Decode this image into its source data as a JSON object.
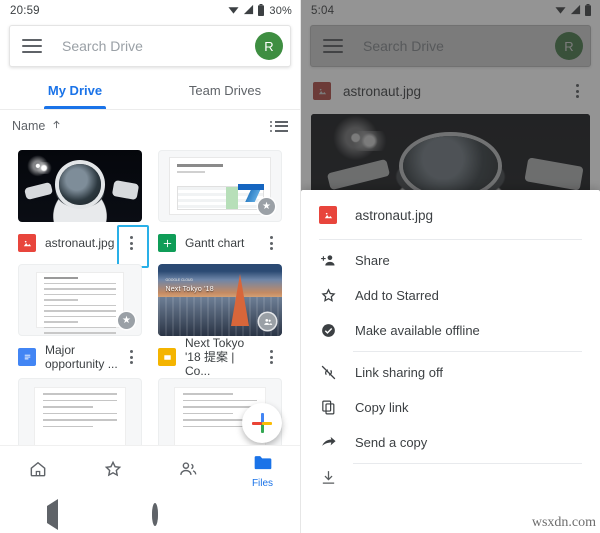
{
  "left": {
    "status": {
      "time": "20:59",
      "battery": "30%",
      "icons": [
        "wifi-icon",
        "signal-icon",
        "battery-icon"
      ]
    },
    "search": {
      "placeholder": "Search Drive",
      "menu_icon": "hamburger-menu-icon",
      "avatar_letter": "R",
      "avatar_color": "#3e8e41"
    },
    "tabs": [
      {
        "label": "My Drive",
        "active": true
      },
      {
        "label": "Team Drives",
        "active": false
      }
    ],
    "sort": {
      "label": "Name",
      "direction_icon": "arrow-up-icon",
      "view_toggle_icon": "list-view-icon"
    },
    "files": [
      {
        "name": "astronaut.jpg",
        "type_icon": "image-file-icon",
        "type_color": "#e8453c",
        "badge": "",
        "menu_highlighted": true
      },
      {
        "name": "Gantt chart",
        "type_icon": "sheets-file-icon",
        "type_color": "#0f9d58",
        "badge": "star-badge",
        "menu_highlighted": false
      },
      {
        "name": "Major opportunity ...",
        "type_icon": "docs-file-icon",
        "type_color": "#4285f4",
        "badge": "star-badge",
        "menu_highlighted": false
      },
      {
        "name": "Next Tokyo '18 提案 | Co...",
        "type_icon": "slides-file-icon",
        "type_color": "#f4b400",
        "badge": "shared-badge",
        "menu_highlighted": false
      },
      {
        "name": "",
        "type_icon": "",
        "type_color": "",
        "badge": "",
        "menu_highlighted": false
      },
      {
        "name": "",
        "type_icon": "",
        "type_color": "",
        "badge": "",
        "menu_highlighted": false
      }
    ],
    "thumbnails": {
      "tokyo_title": "Next Tokyo '18",
      "tokyo_sub": "GOOGLE CLOUD"
    },
    "fab": {
      "icon": "add-plus-icon",
      "colors": [
        "#4285f4",
        "#ea4335",
        "#fbbc04",
        "#34a853"
      ]
    },
    "bottom_nav": [
      {
        "label": "Home",
        "icon": "home-icon",
        "active": false,
        "show_label": false
      },
      {
        "label": "Starred",
        "icon": "star-icon",
        "active": false,
        "show_label": false
      },
      {
        "label": "Shared",
        "icon": "people-icon",
        "active": false,
        "show_label": false
      },
      {
        "label": "Files",
        "icon": "folder-icon",
        "active": true,
        "show_label": true
      }
    ],
    "android_nav": [
      "back-icon",
      "home-icon",
      "recents-icon"
    ]
  },
  "right": {
    "status": {
      "time": "5:04",
      "battery": "",
      "icons": [
        "wifi-icon",
        "signal-icon",
        "battery-icon"
      ]
    },
    "search": {
      "placeholder": "Search Drive",
      "menu_icon": "hamburger-menu-icon",
      "avatar_letter": "R",
      "avatar_color": "#3e8e41"
    },
    "file_row": {
      "name": "astronaut.jpg",
      "type_icon": "image-file-icon",
      "menu_icon": "kebab-menu-icon"
    },
    "sheet": {
      "title": "astronaut.jpg",
      "title_icon": "image-file-icon",
      "items": [
        {
          "label": "Share",
          "icon": "person-add-icon",
          "divider_after": false,
          "cut": false
        },
        {
          "label": "Add to Starred",
          "icon": "star-outline-icon",
          "divider_after": false,
          "cut": false
        },
        {
          "label": "Make available offline",
          "icon": "offline-check-icon",
          "divider_after": true,
          "cut": false
        },
        {
          "label": "Link sharing off",
          "icon": "link-off-icon",
          "divider_after": false,
          "cut": false
        },
        {
          "label": "Copy link",
          "icon": "copy-icon",
          "divider_after": false,
          "cut": false
        },
        {
          "label": "Send a copy",
          "icon": "send-arrow-icon",
          "divider_after": true,
          "cut": false
        },
        {
          "label": "",
          "icon": "",
          "divider_after": false,
          "cut": true
        }
      ]
    },
    "android_nav": [
      "back-icon",
      "home-icon",
      "recents-icon"
    ]
  },
  "watermark": "wsxdn.com"
}
